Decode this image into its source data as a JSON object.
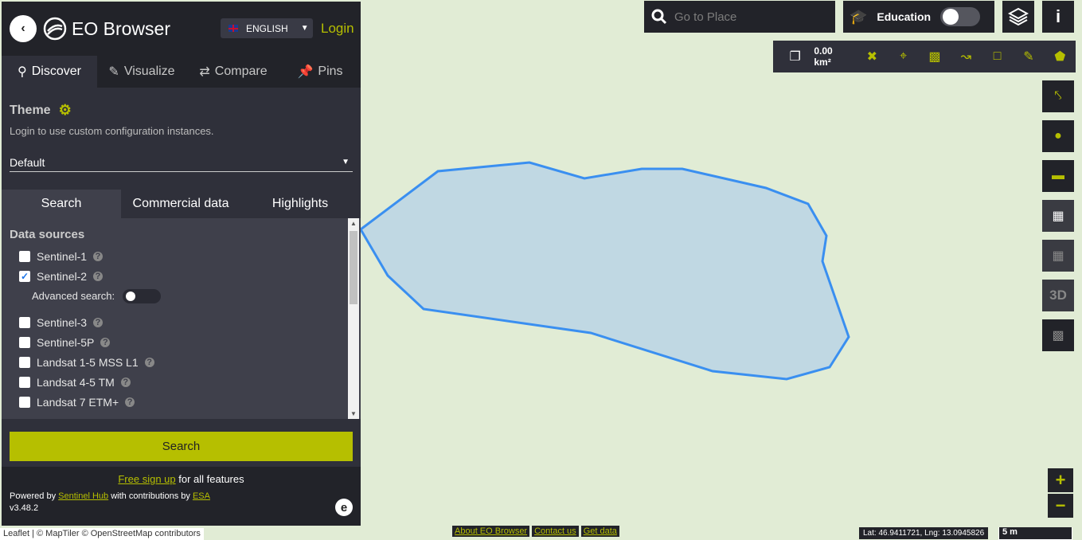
{
  "header": {
    "app_title": "EO Browser",
    "language": "ENGLISH",
    "login": "Login"
  },
  "tabs": [
    {
      "label": "Discover",
      "icon": "search-icon"
    },
    {
      "label": "Visualize",
      "icon": "brush-icon"
    },
    {
      "label": "Compare",
      "icon": "compare-icon"
    },
    {
      "label": "Pins",
      "icon": "pin-icon"
    }
  ],
  "theme": {
    "title": "Theme",
    "note": "Login to use custom configuration instances.",
    "selected": "Default"
  },
  "subtabs": [
    "Search",
    "Commercial data",
    "Highlights"
  ],
  "datasources": {
    "title": "Data sources",
    "advanced_label": "Advanced search:",
    "items": [
      {
        "label": "Sentinel-1",
        "checked": false
      },
      {
        "label": "Sentinel-2",
        "checked": true
      },
      {
        "label": "Sentinel-3",
        "checked": false
      },
      {
        "label": "Sentinel-5P",
        "checked": false
      },
      {
        "label": "Landsat 1-5 MSS L1",
        "checked": false
      },
      {
        "label": "Landsat 4-5 TM",
        "checked": false
      },
      {
        "label": "Landsat 7 ETM+",
        "checked": false
      }
    ]
  },
  "search_button": "Search",
  "footer": {
    "signup_link": "Free sign up",
    "signup_text": " for all features",
    "powered": "Powered by ",
    "sentinel_hub": "Sentinel Hub",
    "contrib": " with contributions by ",
    "esa": "ESA",
    "version": "v3.48.2"
  },
  "goto": {
    "placeholder": "Go to Place"
  },
  "education": {
    "label": "Education",
    "enabled": false
  },
  "toolbar": {
    "area": "0.00 km²"
  },
  "map": {
    "attribution": "Leaflet | © MapTiler © OpenStreetMap contributors",
    "links": [
      "About EO Browser",
      "Contact us",
      "Get data"
    ],
    "coords": "Lat: 46.9411721, Lng: 13.0945826",
    "scale": "5 m",
    "zoom_in": "+",
    "zoom_out": "−",
    "threed": "3D"
  },
  "colors": {
    "accent": "#b6bf00",
    "polygon_stroke": "#3a8ff0",
    "polygon_fill": "#c0d8e3"
  }
}
